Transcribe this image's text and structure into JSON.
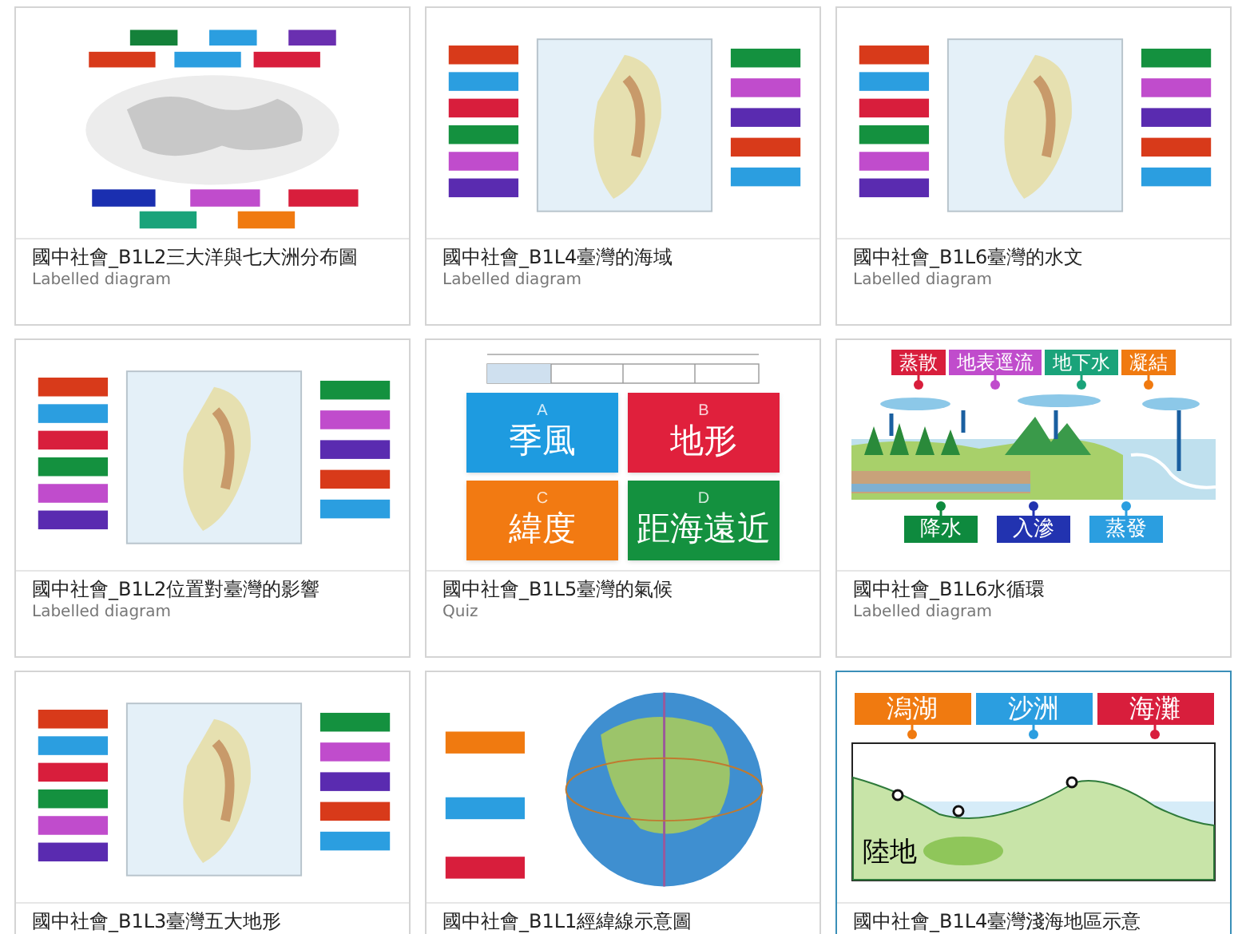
{
  "cards": [
    {
      "title": "國中社會_B1L2三大洋與七大洲分布圖",
      "type": "Labelled diagram",
      "selected": false
    },
    {
      "title": "國中社會_B1L4臺灣的海域",
      "type": "Labelled diagram",
      "selected": false
    },
    {
      "title": "國中社會_B1L6臺灣的水文",
      "type": "Labelled diagram",
      "selected": false
    },
    {
      "title": "國中社會_B1L2位置對臺灣的影響",
      "type": "Labelled diagram",
      "selected": false
    },
    {
      "title": "國中社會_B1L5臺灣的氣候",
      "type": "Quiz",
      "selected": false,
      "thumbnail": {
        "kind": "quiz",
        "options": [
          {
            "letter": "A",
            "text": "季風",
            "color": "#1e9be0"
          },
          {
            "letter": "B",
            "text": "地形",
            "color": "#e0203c"
          },
          {
            "letter": "C",
            "text": "緯度",
            "color": "#f27a12"
          },
          {
            "letter": "D",
            "text": "距海遠近",
            "color": "#14913f"
          }
        ]
      }
    },
    {
      "title": "國中社會_B1L6水循環",
      "type": "Labelled diagram",
      "selected": false,
      "thumbnail": {
        "kind": "cycle",
        "top_labels": [
          {
            "text": "蒸散",
            "color": "#d81e3c"
          },
          {
            "text": "地表逕流",
            "color": "#c04ccc"
          },
          {
            "text": "地下水",
            "color": "#1aa37a"
          },
          {
            "text": "凝結",
            "color": "#f07a10"
          }
        ],
        "bottom_labels": [
          {
            "text": "降水",
            "color": "#0e8a3e"
          },
          {
            "text": "入滲",
            "color": "#2233b0"
          },
          {
            "text": "蒸發",
            "color": "#2b9ee0"
          }
        ]
      }
    },
    {
      "title": "國中社會_B1L3臺灣五大地形",
      "selected": false
    },
    {
      "title": "國中社會_B1L1經緯線示意圖",
      "selected": false
    },
    {
      "title": "國中社會_B1L4臺灣淺海地區示意",
      "selected": true,
      "thumbnail": {
        "kind": "coast",
        "top_labels": [
          {
            "text": "潟湖",
            "color": "#f07a10"
          },
          {
            "text": "沙洲",
            "color": "#2b9ee0"
          },
          {
            "text": "海灘",
            "color": "#d81e3c"
          }
        ],
        "land_label": "陸地"
      }
    }
  ]
}
